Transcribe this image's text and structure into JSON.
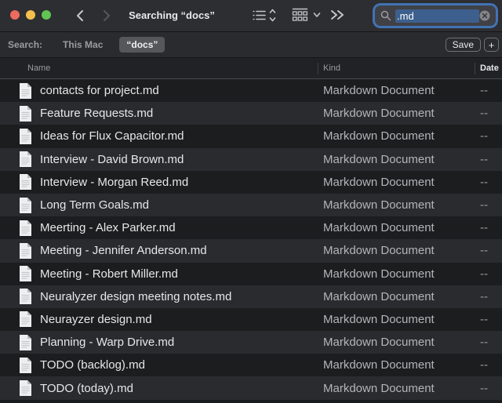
{
  "window": {
    "title": "Searching “docs”"
  },
  "toolbar": {
    "back_icon": "chevron-left",
    "forward_icon": "chevron-right",
    "view_control_icon": "list-view",
    "view_stepper_icon": "up-down-chevrons",
    "group_control_icon": "group-grid",
    "group_chevron_icon": "chevron-down",
    "overflow_icon": "double-chevron-right",
    "search": {
      "value": ".md",
      "icon": "magnifier",
      "clear_icon": "circle-x"
    }
  },
  "scope_bar": {
    "label": "Search:",
    "scopes": [
      {
        "label": "This Mac",
        "selected": false
      },
      {
        "label": "“docs”",
        "selected": true
      }
    ],
    "save_button": "Save",
    "add_button": "+"
  },
  "list": {
    "columns": [
      "Name",
      "Kind",
      "Date"
    ],
    "sorted_column": "Date",
    "files": [
      {
        "name": "contacts for project.md",
        "kind": "Markdown Document",
        "date": "--"
      },
      {
        "name": "Feature Requests.md",
        "kind": "Markdown Document",
        "date": "--"
      },
      {
        "name": "Ideas for Flux Capacitor.md",
        "kind": "Markdown Document",
        "date": "--"
      },
      {
        "name": "Interview - David Brown.md",
        "kind": "Markdown Document",
        "date": "--"
      },
      {
        "name": "Interview - Morgan Reed.md",
        "kind": "Markdown Document",
        "date": "--"
      },
      {
        "name": "Long Term Goals.md",
        "kind": "Markdown Document",
        "date": "--"
      },
      {
        "name": "Meerting - Alex Parker.md",
        "kind": "Markdown Document",
        "date": "--"
      },
      {
        "name": "Meeting - Jennifer Anderson.md",
        "kind": "Markdown Document",
        "date": "--"
      },
      {
        "name": "Meeting - Robert Miller.md",
        "kind": "Markdown Document",
        "date": "--"
      },
      {
        "name": "Neuralyzer design meeting notes.md",
        "kind": "Markdown Document",
        "date": "--"
      },
      {
        "name": "Neurayzer design.md",
        "kind": "Markdown Document",
        "date": "--"
      },
      {
        "name": "Planning - Warp Drive.md",
        "kind": "Markdown Document",
        "date": "--"
      },
      {
        "name": "TODO (backlog).md",
        "kind": "Markdown Document",
        "date": "--"
      },
      {
        "name": "TODO (today).md",
        "kind": "Markdown Document",
        "date": "--"
      }
    ]
  },
  "colors": {
    "traffic_red": "#ed6a5e",
    "traffic_yellow": "#f4bf4f",
    "traffic_green": "#61c553",
    "focus_ring": "#4173b4",
    "text_selection": "#3d5f8d",
    "row_dark": "#1c1d1f",
    "row_light": "#2a2b2e"
  }
}
